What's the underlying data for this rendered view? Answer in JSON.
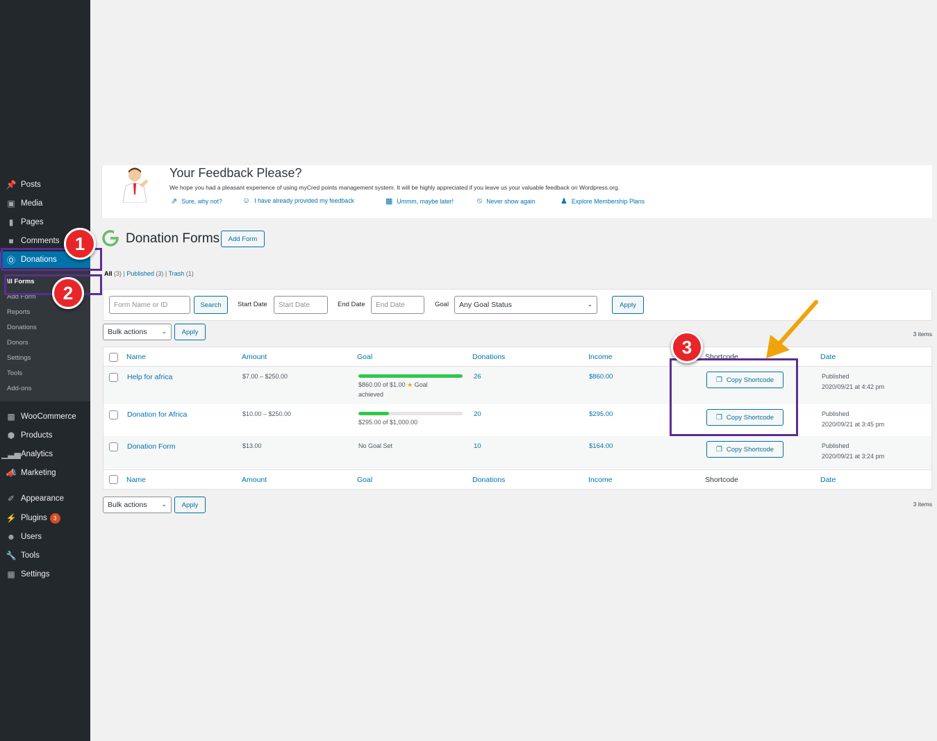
{
  "sidebar": {
    "items": [
      {
        "label": "Posts",
        "icon": "pin-icon"
      },
      {
        "label": "Media",
        "icon": "media-icon"
      },
      {
        "label": "Pages",
        "icon": "pages-icon"
      },
      {
        "label": "Comments",
        "icon": "comments-icon"
      },
      {
        "label": "Donations",
        "icon": "donations-icon"
      },
      {
        "label": "WooCommerce",
        "icon": "woocommerce-icon"
      },
      {
        "label": "Products",
        "icon": "products-icon"
      },
      {
        "label": "Analytics",
        "icon": "analytics-icon"
      },
      {
        "label": "Marketing",
        "icon": "marketing-icon"
      },
      {
        "label": "Appearance",
        "icon": "appearance-icon"
      },
      {
        "label": "Plugins",
        "icon": "plugins-icon"
      },
      {
        "label": "Users",
        "icon": "users-icon"
      },
      {
        "label": "Tools",
        "icon": "tools-icon"
      },
      {
        "label": "Settings",
        "icon": "settings-icon"
      }
    ],
    "plugins_badge": "3",
    "submenu": [
      "\\ll Forms",
      "Add Form",
      "Reports",
      "Donations",
      "Donors",
      "Settings",
      "Tools",
      "Add-ons"
    ]
  },
  "feedback": {
    "title": "Your Feedback Please?",
    "text": "We hope you had a pleasant experience of using myCred points management system. It will be highly appreciated if you leave us your valuable feedback on Wordpress.org.",
    "links": [
      "Sure, why not?",
      "I have already provided my feedback",
      "Ummm, maybe later!",
      "Never show again",
      "Explore Membership Plans"
    ]
  },
  "page": {
    "title": "Donation Forms",
    "add_form": "Add Form",
    "views": {
      "all": "All",
      "all_count": "(3)",
      "published": "Published",
      "published_count": "(3)",
      "trash": "Trash",
      "trash_count": "(1)"
    }
  },
  "filters": {
    "search_placeholder": "Form Name or ID",
    "search_button": "Search",
    "start_date_label": "Start Date",
    "start_date_placeholder": "Start Date",
    "end_date_label": "End Date",
    "end_date_placeholder": "End Date",
    "goal_label": "Goal",
    "goal_selected": "Any Goal Status",
    "apply": "Apply"
  },
  "bulk": {
    "label": "Bulk actions",
    "apply": "Apply",
    "items_count": "3 items"
  },
  "table": {
    "columns": [
      "Name",
      "Amount",
      "Goal",
      "Donations",
      "Income",
      "Shortcode",
      "Date"
    ],
    "rows": [
      {
        "name": "Help for africa",
        "amount": "$7.00 – $250.00",
        "goal_text": "$860.00 of $1.00",
        "goal_note": "Goal",
        "goal_note2": "achieved",
        "goal_progress": 1.0,
        "donations": "26",
        "income": "$860.00",
        "shortcode": "Copy Shortcode",
        "status": "Published",
        "date": "2020/09/21 at 4:42 pm"
      },
      {
        "name": "Donation for Africa",
        "amount": "$10.00 – $250.00",
        "goal_text": "$295.00 of $1,000.00",
        "goal_progress": 0.295,
        "donations": "20",
        "income": "$295.00",
        "shortcode": "Copy Shortcode",
        "status": "Published",
        "date": "2020/09/21 at 3:45 pm"
      },
      {
        "name": "Donation Form",
        "amount": "$13.00",
        "goal_text": "No Goal Set",
        "donations": "10",
        "income": "$164.00",
        "shortcode": "Copy Shortcode",
        "status": "Published",
        "date": "2020/09/21 at 3:24 pm"
      }
    ]
  },
  "annotations": [
    "1",
    "2",
    "3"
  ],
  "colors": {
    "sidebar": "#23282d",
    "active": "#0073aa",
    "highlight": "#5c2d91",
    "badge": "#e8262a",
    "arrow": "#f0a30a",
    "progress": "#2ec94b"
  }
}
